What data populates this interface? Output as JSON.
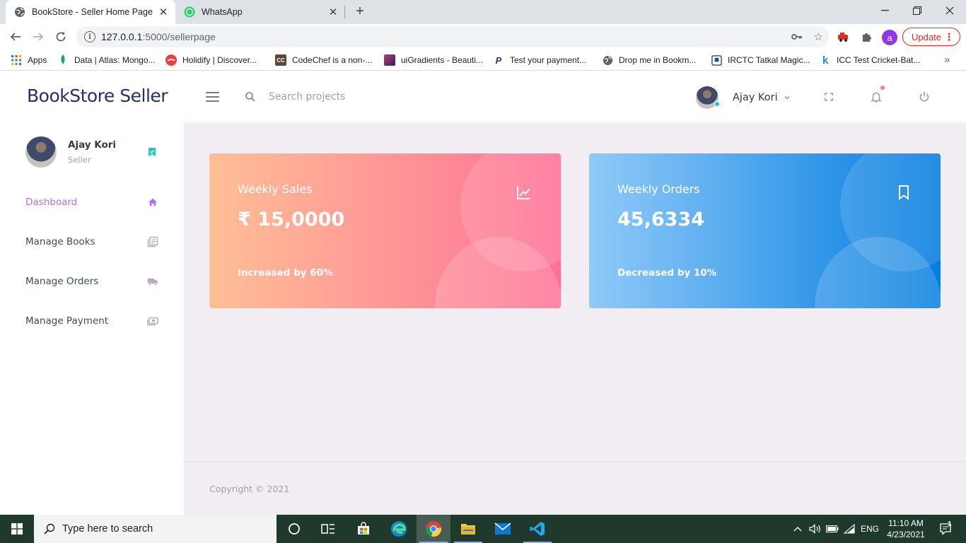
{
  "browser": {
    "tabs": [
      {
        "title": "BookStore - Seller Home Page",
        "active": true
      },
      {
        "title": "WhatsApp",
        "active": false
      }
    ],
    "url_host": "127.0.0.1",
    "url_path": ":5000/sellerpage",
    "profile_initial": "a",
    "update_label": "Update",
    "bookmarks": [
      {
        "label": "Apps"
      },
      {
        "label": "Data | Atlas: Mongo..."
      },
      {
        "label": "Holidify | Discover..."
      },
      {
        "label": "CodeChef is a non-..."
      },
      {
        "label": "uiGradients - Beauti..."
      },
      {
        "label": "Test your payment..."
      },
      {
        "label": "Drop me in Bookm..."
      },
      {
        "label": "IRCTC Tatkal Magic..."
      },
      {
        "label": "ICC Test Cricket-Bat..."
      }
    ]
  },
  "header": {
    "brand": "BookStore Seller",
    "search_placeholder": "Search projects",
    "user_name": "Ajay Kori"
  },
  "sidebar": {
    "profile_name": "Ajay Kori",
    "profile_role": "Seller",
    "items": [
      {
        "label": "Dashboard",
        "icon": "home-icon",
        "active": true
      },
      {
        "label": "Manage Books",
        "icon": "books-icon",
        "active": false
      },
      {
        "label": "Manage Orders",
        "icon": "truck-icon",
        "active": false
      },
      {
        "label": "Manage Payment",
        "icon": "cash-icon",
        "active": false
      }
    ]
  },
  "cards": [
    {
      "title": "Weekly Sales",
      "value": "₹ 15,0000",
      "note": "Increased by 60%",
      "icon": "chart-line-icon"
    },
    {
      "title": "Weekly Orders",
      "value": "45,6334",
      "note": "Decreased by 10%",
      "icon": "bookmark-icon"
    }
  ],
  "footer": {
    "copyright": "Copyright © 2021"
  },
  "taskbar": {
    "search_label": "Type here to search",
    "language": "ENG",
    "time": "11:10 AM",
    "date": "4/23/2021",
    "notification_count": "1"
  },
  "colors": {
    "accent_purple": "#b66dff",
    "sales_gradient": [
      "#ffbf96",
      "#fe7096"
    ],
    "orders_gradient": [
      "#90caf9",
      "#047edf"
    ],
    "online_green": "#1bcfb4",
    "brand_navy": "#24306a",
    "content_bg": "#f2edf3"
  }
}
